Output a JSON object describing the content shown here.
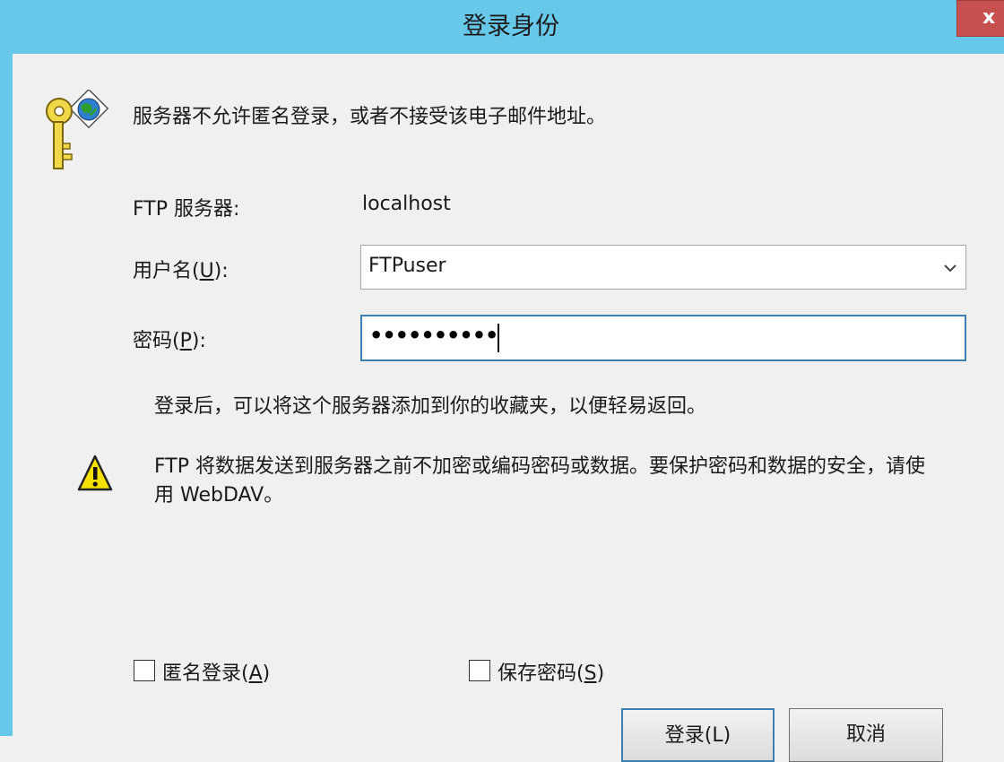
{
  "window": {
    "title": "登录身份",
    "close_glyph": "x"
  },
  "message": "服务器不允许匿名登录，或者不接受该电子邮件地址。",
  "ftp_server": {
    "label": "FTP 服务器:",
    "value": "localhost"
  },
  "username": {
    "label": "用户名(",
    "accesskey": "U",
    "label_end": "):",
    "value": "FTPuser"
  },
  "password": {
    "label": "密码(",
    "accesskey": "P",
    "label_end": "):",
    "masked_value": "••••••••••"
  },
  "favorites_note": "登录后，可以将这个服务器添加到你的收藏夹，以便轻易返回。",
  "warning": {
    "line1": "FTP 将数据发送到服务器之前不加密或编码密码或数据。要保护密码和数据的安全，请使",
    "line2": "用 WebDAV。"
  },
  "anonymous": {
    "label": "匿名登录(",
    "accesskey": "A",
    "label_end": ")",
    "checked": false
  },
  "save_password": {
    "label": "保存密码(",
    "accesskey": "S",
    "label_end": ")",
    "checked": false
  },
  "buttons": {
    "login": "登录(L)",
    "cancel": "取消"
  },
  "icons": {
    "key": "key-globe-icon",
    "warning": "warning-icon",
    "dropdown": "chevron-down-icon"
  },
  "colors": {
    "titlebar": "#67c8ea",
    "close": "#c75050",
    "focus": "#3c7fb1",
    "warning": "#f5e100"
  }
}
